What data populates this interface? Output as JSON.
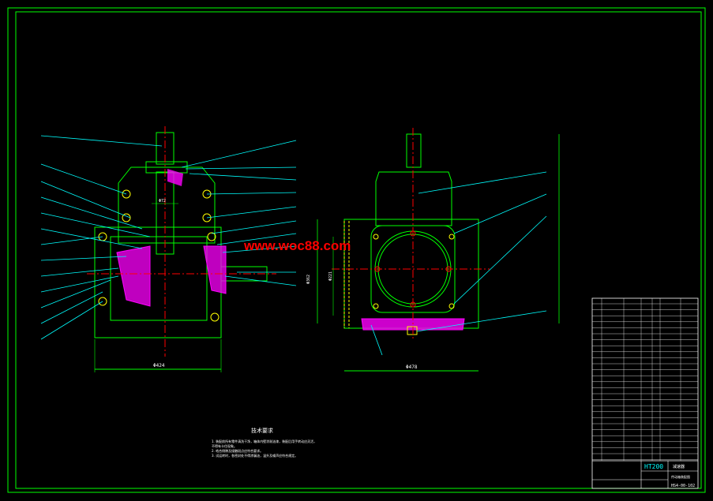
{
  "watermark": "www.woc88.com",
  "dimensions": {
    "left_width": "Φ424",
    "right_width": "Φ478",
    "right_height": "Φ362",
    "center_height": "Φ221",
    "shaft_dia": "Φ72"
  },
  "tech_requirements": {
    "title": "技术要求",
    "lines": [
      "1. 装配前所有零件清洗干净，箱体内壁涂耐油漆，装配后用手转动应灵活，",
      "   不得有卡住现象。",
      "2. 啮合侧隙及接触斑点应符合要求。",
      "3. 试运转时，各密封处不得渗漏油，温升及噪声应符合规定。"
    ]
  },
  "title_block": {
    "model": "HT200",
    "drawing_no": "HS4-00-102",
    "name": "减速器",
    "subtitle": "传动箱装配图"
  },
  "colors": {
    "frame": "#00ff00",
    "outline": "#00ff00",
    "leader": "#00ffff",
    "cutline": "#ff0000",
    "hatch": "#ff00ff",
    "text": "#ffffff",
    "yellow": "#ffff00",
    "watermark": "#ff0000"
  }
}
